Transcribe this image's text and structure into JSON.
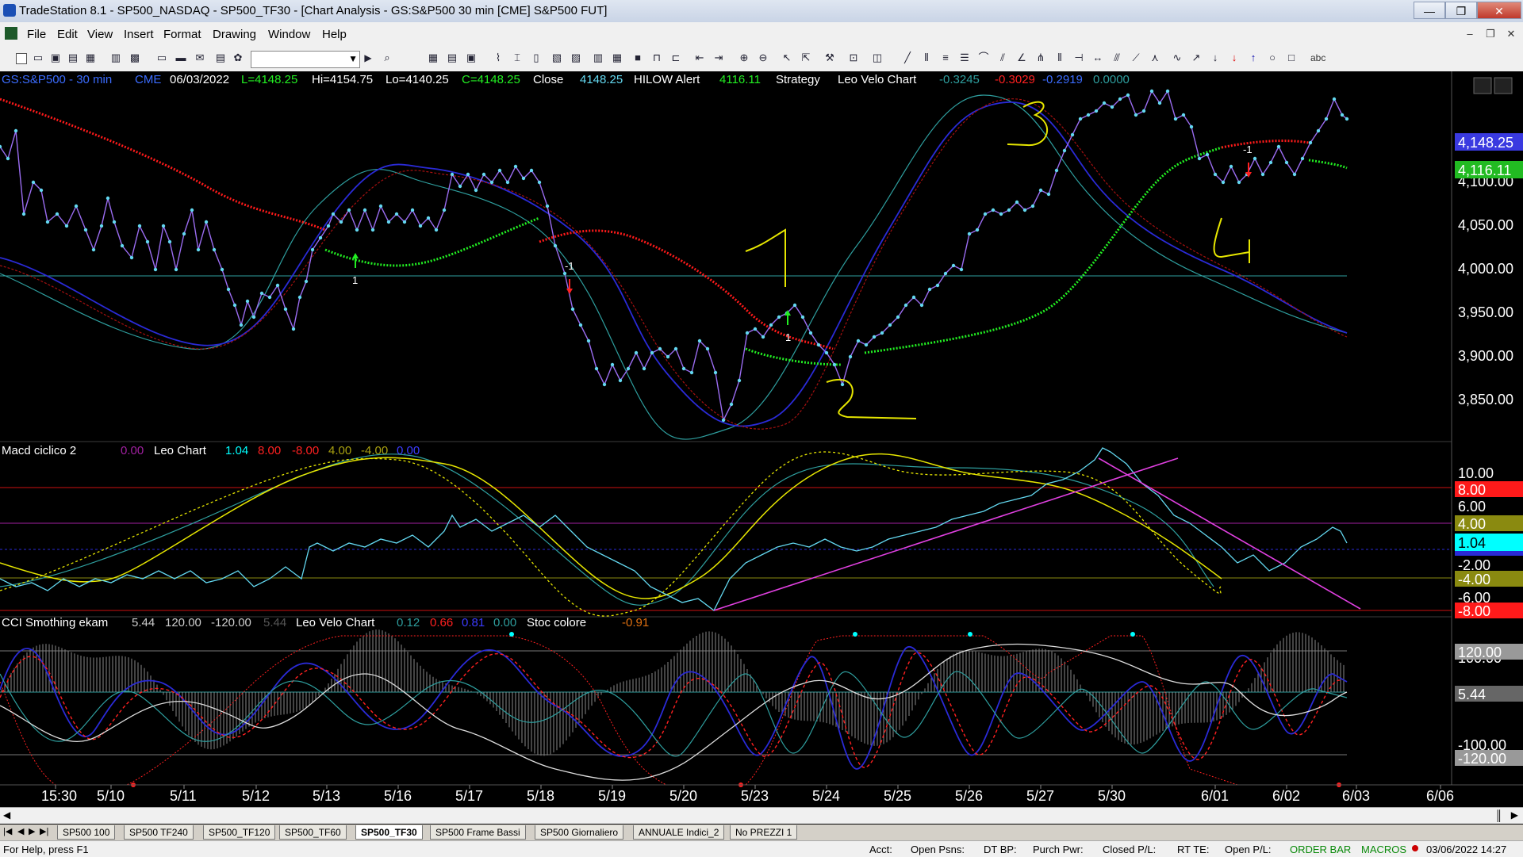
{
  "window": {
    "title": "TradeStation 8.1 - SP500_NASDAQ - SP500_TF30 - [Chart Analysis - GS:S&P500  30 min  [CME] S&P500 FUT]",
    "minimize": "—",
    "restore": "❐",
    "close": "✕"
  },
  "menu": {
    "items": [
      "File",
      "Edit",
      "View",
      "Insert",
      "Format",
      "Drawing",
      "Window",
      "Help"
    ]
  },
  "mdi_buttons": {
    "minimize": "–",
    "restore": "❐",
    "close": "✕"
  },
  "toolbar": {
    "text_tool": "abc"
  },
  "header": {
    "symbol": "GS:S&P500 - 30 min",
    "exchange": "CME",
    "date": "06/03/2022",
    "last": "L=4148.25",
    "high": "Hi=4154.75",
    "low": "Lo=4140.25",
    "close": "C=4148.25",
    "close_label": "Close",
    "close_value": "4148.25",
    "hilow_label": "HILOW Alert",
    "hilow_value": "4116.11",
    "strategy_label": "Strategy",
    "velo_label": "Leo Velo Chart",
    "velo_v1": "-0.3245",
    "velo_v2": "-0.3029",
    "velo_v3": "-0.2919",
    "velo_v4": "0.0000"
  },
  "macd_header": {
    "name": "Macd ciclico 2",
    "v0": "0.00",
    "leo": "Leo Chart",
    "v1": "1.04",
    "v2": "8.00",
    "v3": "-8.00",
    "v4": "4.00",
    "v5": "-4.00",
    "v6": "0.00"
  },
  "cci_header": {
    "name": "CCI Smothing ekam",
    "v1": "5.44",
    "v2": "120.00",
    "v3": "-120.00",
    "v4": "5.44",
    "velo": "Leo Velo Chart",
    "s1": "0.12",
    "s2": "0.66",
    "s3": "0.81",
    "s4": "0.00",
    "stoc": "Stoc colore",
    "s5": "-0.91"
  },
  "price_axis": [
    "4,100.00",
    "4,050.00",
    "4,000.00",
    "3,950.00",
    "3,900.00",
    "3,850.00"
  ],
  "price_badges": {
    "last": "4,148.25",
    "alert": "4,116.11"
  },
  "macd_axis": {
    "t10": "10.00",
    "t6": "6.00",
    "tm2": "-2.00",
    "tm6": "-6.00",
    "b8": "8.00",
    "b4": "4.00",
    "b104": "1.04",
    "bm4": "-4.00",
    "bm8": "-8.00"
  },
  "cci_axis": {
    "t100": "100.00",
    "tm100": "-100.00",
    "b120": "120.00",
    "b544": "5.44",
    "bm120": "-120.00"
  },
  "time_axis": [
    "15:30",
    "5/10",
    "5/11",
    "5/12",
    "5/13",
    "5/16",
    "5/17",
    "5/18",
    "5/19",
    "5/20",
    "5/23",
    "5/24",
    "5/25",
    "5/26",
    "5/27",
    "5/30",
    "6/01",
    "6/02",
    "6/03",
    "6/06"
  ],
  "annotations": {
    "signal_1": "1",
    "signal_m1": "-1",
    "hand_1": "1",
    "hand_2": "2",
    "hand_3": "3",
    "hand_4": "4"
  },
  "tabs": [
    "SP500 100",
    "SP500 TF240",
    "SP500_TF120",
    "SP500_TF60",
    "SP500_TF30",
    "SP500 Frame Bassi",
    "SP500 Giornaliero",
    "ANNUALE Indici_2",
    "No PREZZI 1"
  ],
  "active_tab": "SP500_TF30",
  "status": {
    "help": "For Help, press F1",
    "acct": "Acct:",
    "open_psns": "Open Psns:",
    "dt_bp": "DT BP:",
    "purch_pwr": "Purch Pwr:",
    "closed_pl": "Closed P/L:",
    "rt_te": "RT TE:",
    "open_pl": "Open P/L:",
    "order_bar": "ORDER BAR",
    "macros": "MACROS",
    "datetime": "03/06/2022 14:27"
  },
  "colors": {
    "price": "#63d8f0",
    "sma_red": "#ff1a1a",
    "sma_green": "#22ee22",
    "blue_band": "#2a2ad6",
    "teal_band": "#2e9e9e",
    "darkred": "#a51010",
    "yellow": "#e6e600",
    "magenta": "#e040e0"
  }
}
